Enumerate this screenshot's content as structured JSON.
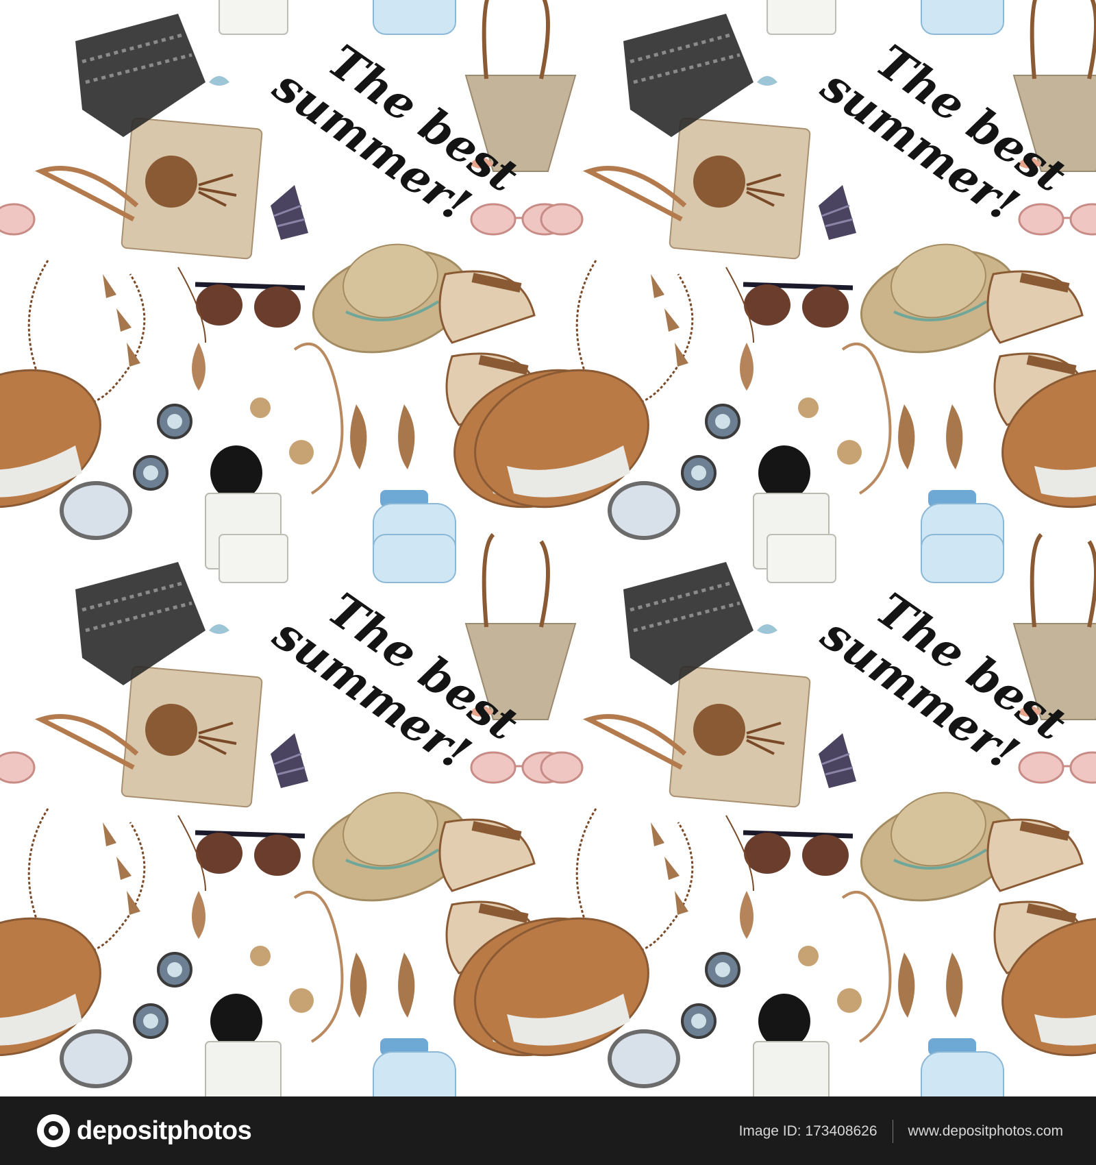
{
  "artwork": {
    "pattern_text_line1": "The best",
    "pattern_text_line2": "summer!",
    "palette": {
      "straw": "#c9b28e",
      "leather": "#8a5a34",
      "tan": "#b98a5f",
      "pink_lens": "#e9b9b4",
      "blue_glass": "#a9d2ec",
      "shell_purple": "#4a4460",
      "black": "#151515",
      "background": "#ffffff"
    },
    "items": [
      "straw-tote-bag",
      "beaded-sandal",
      "woven-clutch",
      "pink-sunglasses",
      "dark-sunglasses",
      "straw-hat",
      "leather-sandals",
      "feather-necklace",
      "feather-earrings",
      "brown-cloche-hat",
      "gemstone-ring",
      "blue-stud-earrings",
      "perfume-bottle-black",
      "blue-perfume-bottle",
      "seashell",
      "bangle-bracelet"
    ]
  },
  "footer": {
    "logo_text": "depositphotos",
    "image_id": "Image ID: 173408626",
    "website": "www.depositphotos.com",
    "background": "#1b1b1b"
  }
}
